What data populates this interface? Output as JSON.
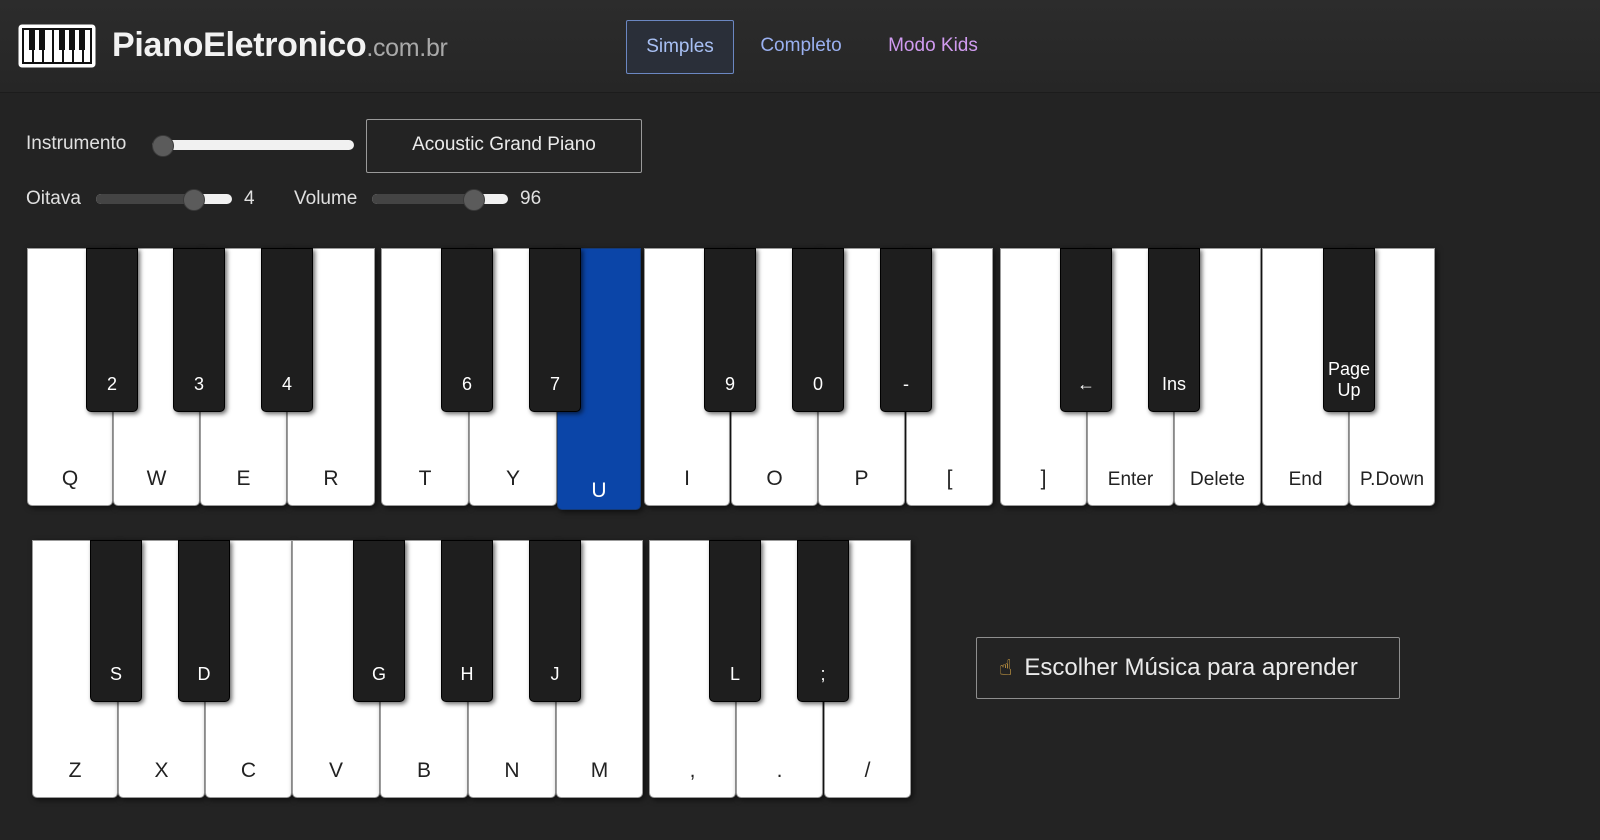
{
  "site": {
    "name": "PianoEletronico",
    "domain": ".com.br",
    "logo_icon": "piano-keys-icon"
  },
  "nav": {
    "tabs": [
      {
        "label": "Simples",
        "active": true
      },
      {
        "label": "Completo",
        "active": false
      },
      {
        "label": "Modo Kids",
        "active": false
      }
    ]
  },
  "controls": {
    "instrument_label": "Instrumento",
    "instrument_value": "Acoustic Grand Piano",
    "instrument_slider_fraction": 0.0,
    "octave_label": "Oitava",
    "octave_value": "4",
    "octave_fraction": 0.71,
    "volume_label": "Volume",
    "volume_value": "96",
    "volume_fraction": 0.74
  },
  "keyboard_top": {
    "white_keys": [
      "Q",
      "W",
      "E",
      "R",
      "T",
      "Y",
      "U",
      "I",
      "O",
      "P",
      "[",
      "]",
      "Enter",
      "Delete",
      "End",
      "P.Down"
    ],
    "active_key": "U",
    "black_keys": [
      "2",
      "3",
      "4",
      "6",
      "7",
      "9",
      "0",
      "-",
      "←",
      "Ins",
      "Page Up"
    ]
  },
  "keyboard_bottom": {
    "white_keys": [
      "Z",
      "X",
      "C",
      "V",
      "B",
      "N",
      "M",
      ",",
      ".",
      "/"
    ],
    "black_keys": [
      "S",
      "D",
      "G",
      "H",
      "J",
      "L",
      ";"
    ]
  },
  "learn_button": {
    "label": "Escolher Música para aprender",
    "icon": "pointing-up-hand-icon",
    "emoji": "☝"
  },
  "colors": {
    "background": "#232323",
    "active_key": "#0b45a8",
    "nav_link": "#9ab0f0",
    "nav_kids": "#d09bf0"
  }
}
